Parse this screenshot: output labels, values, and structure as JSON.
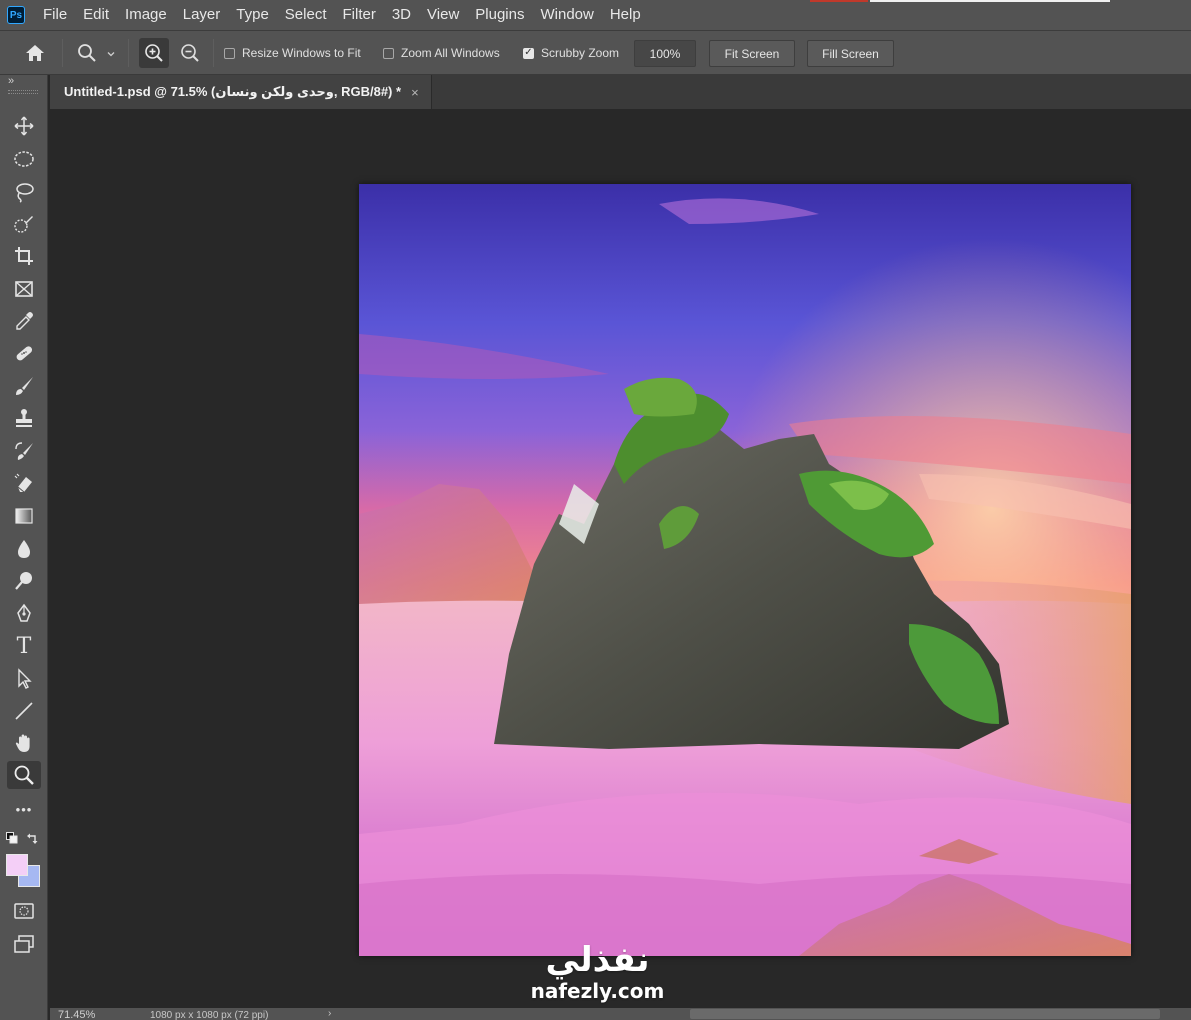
{
  "app": {
    "logo": "Ps"
  },
  "menu": [
    "File",
    "Edit",
    "Image",
    "Layer",
    "Type",
    "Select",
    "Filter",
    "3D",
    "View",
    "Plugins",
    "Window",
    "Help"
  ],
  "options": {
    "resize_windows": {
      "label": "Resize Windows to Fit",
      "checked": false
    },
    "zoom_all": {
      "label": "Zoom All Windows",
      "checked": false
    },
    "scrubby": {
      "label": "Scrubby Zoom",
      "checked": true,
      "mark": "✓"
    },
    "zoom_value": "100%",
    "fit_screen": "Fit Screen",
    "fill_screen": "Fill Screen"
  },
  "document": {
    "tab_title": "Untitled-1.psd @ 71.5% (وحدى ولكن ونسان, RGB/8#) *",
    "close": "×"
  },
  "toolbar": {
    "collapse": "»",
    "tools": [
      "move-tool",
      "elliptical-marquee-tool",
      "lasso-tool",
      "quick-selection-tool",
      "crop-tool",
      "frame-tool",
      "eyedropper-tool",
      "healing-brush-tool",
      "brush-tool",
      "clone-stamp-tool",
      "history-brush-tool",
      "eraser-tool",
      "gradient-tool",
      "blur-tool",
      "dodge-tool",
      "pen-tool",
      "type-tool",
      "path-selection-tool",
      "line-tool",
      "hand-tool",
      "zoom-tool",
      "edit-toolbar",
      "quick-mask",
      "screen-mode"
    ],
    "active_tool": "zoom-tool",
    "edit_toolbar_glyph": "•••",
    "type_glyph": "T",
    "foreground_color": "#f4cff7",
    "background_color": "#a6b8f2"
  },
  "status": {
    "zoom": "71.45%",
    "info": "1080 px x 1080 px (72 ppi)",
    "arrow": "›"
  },
  "watermark": {
    "arabic": "نفذلي",
    "latin": "nafezly.com"
  }
}
